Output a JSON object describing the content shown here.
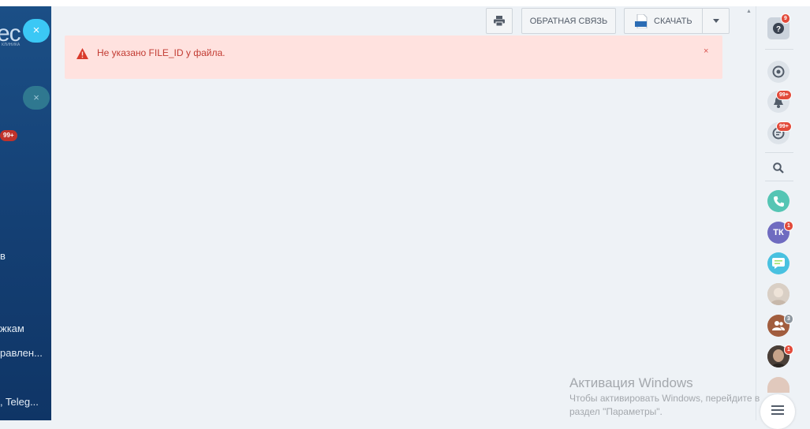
{
  "sidebar": {
    "logo": "ec",
    "logo_sub": "КЛИНИКА",
    "close_icon": "×",
    "badge": "99+",
    "items": [
      "в",
      "жкам",
      "равлен...",
      ", Teleg..."
    ]
  },
  "toolbar": {
    "feedback_label": "ОБРАТНАЯ СВЯЗЬ",
    "download_label": "СКАЧАТЬ",
    "doc_icon_text": "DOC"
  },
  "alert": {
    "message": "Не указано FILE_ID у файла.",
    "close": "×"
  },
  "right_panel": {
    "help_badge": "9",
    "notifications_badge": "99+",
    "messages_badge": "99+",
    "tk_initials": "ТК",
    "tk_badge": "1",
    "group_badge": "3",
    "person_badge": "1"
  },
  "watermark": {
    "title": "Активация Windows",
    "line1": "Чтобы активировать Windows, перейдите в",
    "line2": "раздел \"Параметры\"."
  },
  "colors": {
    "accent": "#3bc8f5",
    "sidebar": "#1b4f86",
    "alert_bg": "#ffe2df",
    "alert_text": "#c23b32",
    "badge": "#e24b3b"
  }
}
